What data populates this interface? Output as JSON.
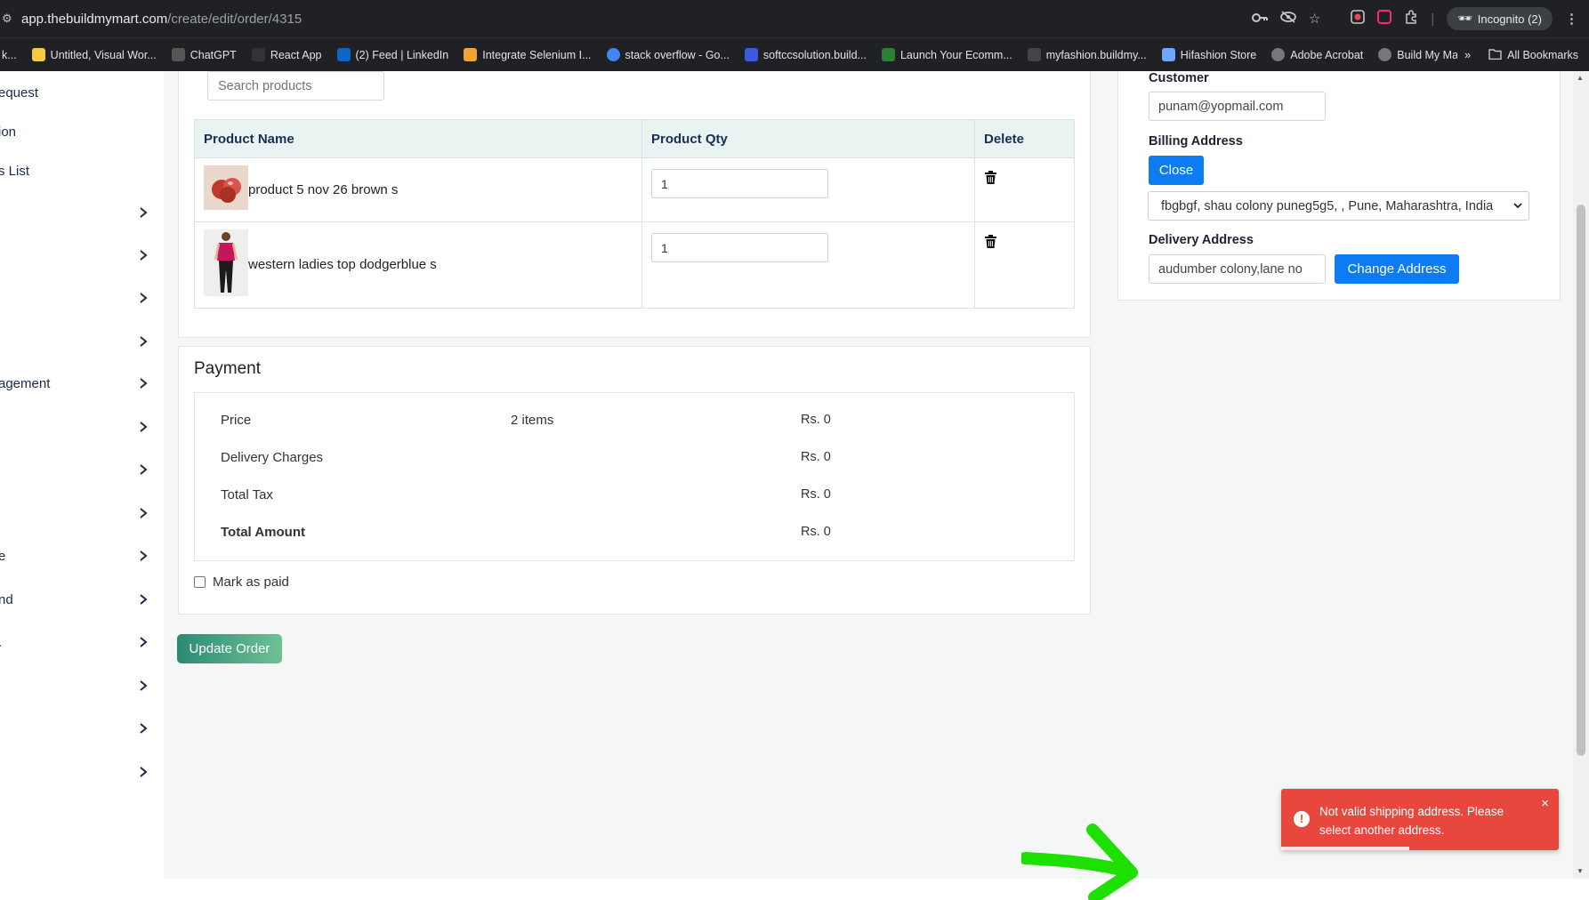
{
  "browser": {
    "url_main": "app.thebuildmymart.com",
    "url_path": "/create/edit/order/4315",
    "incognito_label": "Incognito (2)",
    "bookmarks": [
      {
        "label": "k...",
        "icon": "generic-icon"
      },
      {
        "label": "Untitled, Visual Wor...",
        "icon": "miro-icon"
      },
      {
        "label": "ChatGPT",
        "icon": "chatgpt-icon"
      },
      {
        "label": "React App",
        "icon": "react-app-icon"
      },
      {
        "label": "(2) Feed | LinkedIn",
        "icon": "linkedin-icon"
      },
      {
        "label": "Integrate Selenium I...",
        "icon": "selenium-icon"
      },
      {
        "label": "stack overflow - Go...",
        "icon": "google-icon"
      },
      {
        "label": "softccsolution.build...",
        "icon": "site-icon"
      },
      {
        "label": "Launch Your Ecomm...",
        "icon": "shop-icon"
      },
      {
        "label": "myfashion.buildmy...",
        "icon": "site-icon"
      },
      {
        "label": "Hifashion Store",
        "icon": "store-icon"
      },
      {
        "label": "Adobe Acrobat",
        "icon": "globe-icon"
      },
      {
        "label": "Build My Mart",
        "icon": "globe-icon"
      }
    ],
    "more_bookmarks": "»",
    "all_bookmarks": "All Bookmarks"
  },
  "sidebar": {
    "items": [
      {
        "label": "equest",
        "chevron": false
      },
      {
        "label": "ion",
        "chevron": false
      },
      {
        "label": "s List",
        "chevron": false
      },
      {
        "label": "",
        "chevron": true
      },
      {
        "label": "",
        "chevron": true
      },
      {
        "label": "",
        "chevron": true
      },
      {
        "label": "",
        "chevron": true
      },
      {
        "label": "agement",
        "chevron": true
      },
      {
        "label": "",
        "chevron": true
      },
      {
        "label": "",
        "chevron": true
      },
      {
        "label": "",
        "chevron": true
      },
      {
        "label": "e",
        "chevron": true
      },
      {
        "label": "nd",
        "chevron": true
      },
      {
        "label": ".",
        "chevron": true
      },
      {
        "label": "",
        "chevron": true
      },
      {
        "label": "",
        "chevron": true
      },
      {
        "label": "",
        "chevron": true
      }
    ]
  },
  "products": {
    "search_placeholder": "Search products",
    "columns": [
      "Product Name",
      "Product Qty",
      "Delete"
    ],
    "rows": [
      {
        "name": "product 5 nov 26 brown s",
        "qty": "1",
        "thumb": "apple-icon"
      },
      {
        "name": "western ladies top dodgerblue s",
        "qty": "1",
        "thumb": "fashion-model-icon"
      }
    ]
  },
  "payment": {
    "title": "Payment",
    "rows": [
      {
        "label": "Price",
        "mid": "2 items",
        "value": "Rs. 0",
        "bold": false
      },
      {
        "label": "Delivery Charges",
        "mid": "",
        "value": "Rs. 0",
        "bold": false
      },
      {
        "label": "Total Tax",
        "mid": "",
        "value": "Rs. 0",
        "bold": false
      },
      {
        "label": "Total Amount",
        "mid": "",
        "value": "Rs. 0",
        "bold": true
      }
    ],
    "mark_as_paid": "Mark as paid",
    "mark_as_paid_checked": false
  },
  "actions": {
    "update_order": "Update Order"
  },
  "customer_panel": {
    "customer_label": "Customer",
    "customer_value": "punam@yopmail.com",
    "billing_label": "Billing Address",
    "close_button": "Close",
    "billing_select_value": "fbgbgf, shau colony puneg5g5, , Pune, Maharashtra, India",
    "delivery_label": "Delivery Address",
    "delivery_value": "audumber colony,lane no",
    "change_address_button": "Change Address"
  },
  "toast": {
    "message": "Not valid shipping address. Please select another address.",
    "close": "×",
    "color": "#e7473c",
    "progress_fraction": 0.46
  },
  "colors": {
    "accent_blue": "#0d7bf2",
    "update_green_start": "#2c8a73",
    "update_green_end": "#6fc096",
    "annotation_arrow": "#1ee000"
  }
}
